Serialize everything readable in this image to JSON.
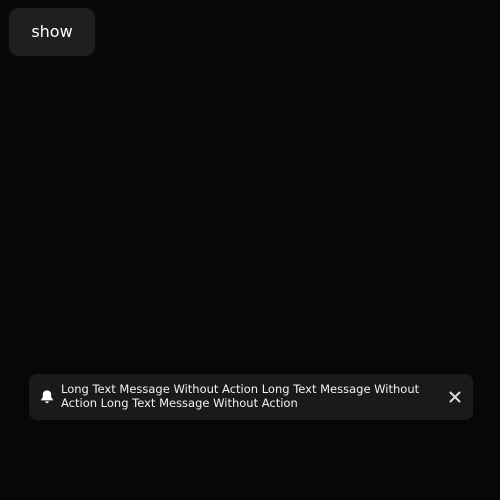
{
  "controls": {
    "show_label": "show"
  },
  "toast": {
    "icon": "bell-icon",
    "message": "Long Text Message Without Action Long Text Message Without Action Long Text Message Without Action",
    "close_icon": "close-icon"
  },
  "colors": {
    "background": "#070707",
    "button_background": "#1f1f1f",
    "toast_background": "#1a1a1a",
    "text": "#ffffff"
  }
}
